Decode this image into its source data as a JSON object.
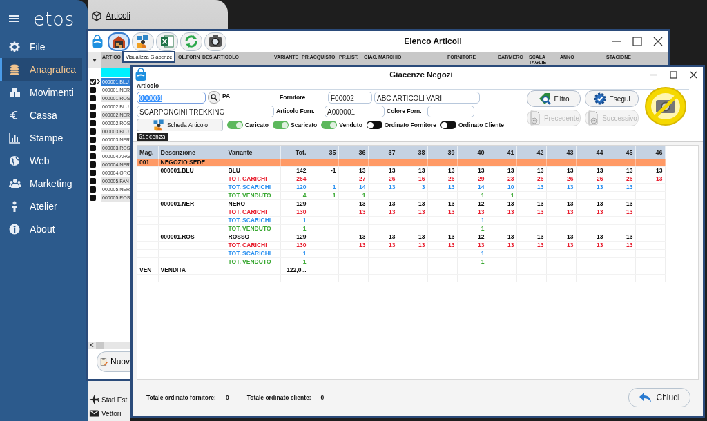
{
  "sidebar": {
    "logo": "etos",
    "items": [
      {
        "label": "File",
        "selected": false
      },
      {
        "label": "Anagrafica",
        "selected": true
      },
      {
        "label": "Movimenti",
        "selected": false
      },
      {
        "label": "Cassa",
        "selected": false
      },
      {
        "label": "Stampe",
        "selected": false
      },
      {
        "label": "Web",
        "selected": false
      },
      {
        "label": "Marketing",
        "selected": false
      },
      {
        "label": "Atelier",
        "selected": false
      },
      {
        "label": "About",
        "selected": false
      }
    ]
  },
  "articoli_tab": {
    "title": "Articoli"
  },
  "elenco_window": {
    "title": "Elenco Articoli",
    "tooltip": "Visualizza Giacenze",
    "toolbar": [
      {
        "selected": true
      },
      {
        "selected": false
      },
      {
        "selected": false
      },
      {
        "selected": false
      },
      {
        "selected": false
      }
    ],
    "columns": [
      "ARTICO",
      "OL.FORN",
      "DES.ARTICOLO",
      "VARIANTE",
      "PR.ACQUISTO",
      "PR.LIST.",
      "GIAC.",
      "MARCHIO",
      "FORNITORE",
      "CAT/MERC",
      "SCALA TAGLIE",
      "ANNO",
      "STAGIONE"
    ],
    "rows": [
      {
        "code": "000001.BLU",
        "checked": true,
        "selected": true
      },
      {
        "code": "000001.NER",
        "checked": false,
        "selected": false
      },
      {
        "code": "000001.ROS",
        "checked": false,
        "selected": false
      },
      {
        "code": "000002.BLU",
        "checked": false,
        "selected": false
      },
      {
        "code": "000002.NER",
        "checked": false,
        "selected": false
      },
      {
        "code": "000002.ROS",
        "checked": false,
        "selected": false
      },
      {
        "code": "000003.BLU",
        "checked": false,
        "selected": false
      },
      {
        "code": "000003.NER",
        "checked": false,
        "selected": false
      },
      {
        "code": "000003.ROS",
        "checked": false,
        "selected": false
      },
      {
        "code": "000004.ARG",
        "checked": false,
        "selected": false
      },
      {
        "code": "000004.NER",
        "checked": false,
        "selected": false
      },
      {
        "code": "000004.ORO",
        "checked": false,
        "selected": false
      },
      {
        "code": "000005.FAN",
        "checked": false,
        "selected": false
      },
      {
        "code": "000005.NER",
        "checked": false,
        "selected": false
      },
      {
        "code": "000005.ROS",
        "checked": false,
        "selected": false
      }
    ],
    "new_button": "Nuov"
  },
  "submenu": {
    "items": [
      "Stati Est",
      "Vettori"
    ]
  },
  "giacenze_window": {
    "title": "Giacenze Negozi",
    "form": {
      "group_label": "Articolo",
      "articolo": "000001",
      "articolo_suffix": "PA",
      "descrizione": "SCARPONCINI TREKKING",
      "fornitore_label": "Fornitore",
      "fornitore_code": "F00002",
      "fornitore_name": "ABC ARTICOLI VARI",
      "articolo_forn_label": "Articolo Forn.",
      "articolo_forn": "A000001",
      "colore_forn_label": "Colore Forn.",
      "scheda_button": "Scheda Articolo",
      "toggles": [
        {
          "label": "Caricato",
          "on": true
        },
        {
          "label": "Scaricato",
          "on": true
        },
        {
          "label": "Venduto",
          "on": true
        },
        {
          "label": "Ordinato Fornitore",
          "on": false
        },
        {
          "label": "Ordinato Cliente",
          "on": false
        }
      ],
      "buttons": [
        {
          "label": "Filtro",
          "disabled": false
        },
        {
          "label": "Esegui",
          "disabled": false
        },
        {
          "label": "Precedente",
          "disabled": true
        },
        {
          "label": "Successivo",
          "disabled": true
        }
      ]
    },
    "tabs": [
      {
        "label": "Giacenza",
        "selected": true
      }
    ],
    "table": {
      "columns": [
        "Mag.",
        "Descrizione",
        "Variante",
        "Tot.",
        "35",
        "36",
        "37",
        "38",
        "39",
        "40",
        "41",
        "42",
        "43",
        "44",
        "45",
        "46"
      ],
      "rows": [
        {
          "kind": "group",
          "mag": "001",
          "descrizione": "NEGOZIO SEDE"
        },
        {
          "kind": "variant",
          "descrizione": "000001.BLU",
          "variante": "BLU",
          "tot": "142",
          "sizes": [
            "-1",
            "13",
            "13",
            "13",
            "13",
            "13",
            "13",
            "13",
            "13",
            "13",
            "13",
            "13"
          ]
        },
        {
          "kind": "carichi",
          "variante": "TOT. CARICHI",
          "tot": "264",
          "sizes": [
            {
              "kind": "empty"
            },
            "27",
            "26",
            "16",
            "26",
            "29",
            "23",
            "26",
            "26",
            "26",
            "26",
            "13"
          ]
        },
        {
          "kind": "scarichi",
          "variante": "TOT. SCARICHI",
          "tot": "120",
          "sizes": [
            "1",
            "14",
            "13",
            "3",
            "13",
            "14",
            "10",
            "13",
            "13",
            "13",
            "13",
            {
              "kind": "empty"
            }
          ]
        },
        {
          "kind": "venduto",
          "variante": "TOT. VENDUTO",
          "tot": "4",
          "sizes": [
            "1",
            "1",
            {
              "kind": "empty"
            },
            {
              "kind": "empty"
            },
            {
              "kind": "empty"
            },
            "1",
            "1",
            {
              "kind": "empty"
            },
            {
              "kind": "empty"
            },
            {
              "kind": "empty"
            },
            {
              "kind": "empty"
            },
            {
              "kind": "empty"
            }
          ]
        },
        {
          "kind": "variant",
          "descrizione": "000001.NER",
          "variante": "NERO",
          "tot": "129",
          "sizes": [
            {
              "kind": "empty"
            },
            "13",
            "13",
            "13",
            "13",
            "12",
            "13",
            "13",
            "13",
            "13",
            "13",
            {
              "kind": "empty"
            }
          ]
        },
        {
          "kind": "carichi",
          "variante": "TOT. CARICHI",
          "tot": "130",
          "sizes": [
            {
              "kind": "empty"
            },
            "13",
            "13",
            "13",
            "13",
            "13",
            "13",
            "13",
            "13",
            "13",
            "13",
            {
              "kind": "empty"
            }
          ]
        },
        {
          "kind": "scarichi",
          "variante": "TOT. SCARICHI",
          "tot": "1",
          "sizes": [
            {
              "kind": "empty"
            },
            {
              "kind": "empty"
            },
            {
              "kind": "empty"
            },
            {
              "kind": "empty"
            },
            {
              "kind": "empty"
            },
            "1",
            {
              "kind": "empty"
            },
            {
              "kind": "empty"
            },
            {
              "kind": "empty"
            },
            {
              "kind": "empty"
            },
            {
              "kind": "empty"
            },
            {
              "kind": "empty"
            }
          ]
        },
        {
          "kind": "venduto",
          "variante": "TOT. VENDUTO",
          "tot": "1",
          "sizes": [
            {
              "kind": "empty"
            },
            {
              "kind": "empty"
            },
            {
              "kind": "empty"
            },
            {
              "kind": "empty"
            },
            {
              "kind": "empty"
            },
            "1",
            {
              "kind": "empty"
            },
            {
              "kind": "empty"
            },
            {
              "kind": "empty"
            },
            {
              "kind": "empty"
            },
            {
              "kind": "empty"
            },
            {
              "kind": "empty"
            }
          ]
        },
        {
          "kind": "variant",
          "descrizione": "000001.ROS",
          "variante": "ROSSO",
          "tot": "129",
          "sizes": [
            {
              "kind": "empty"
            },
            "13",
            "13",
            "13",
            "13",
            "12",
            "13",
            "13",
            "13",
            "13",
            "13",
            {
              "kind": "empty"
            }
          ]
        },
        {
          "kind": "carichi",
          "variante": "TOT. CARICHI",
          "tot": "130",
          "sizes": [
            {
              "kind": "empty"
            },
            "13",
            "13",
            "13",
            "13",
            "13",
            "13",
            "13",
            "13",
            "13",
            "13",
            {
              "kind": "empty"
            }
          ]
        },
        {
          "kind": "scarichi",
          "variante": "TOT. SCARICHI",
          "tot": "1",
          "sizes": [
            {
              "kind": "empty"
            },
            {
              "kind": "empty"
            },
            {
              "kind": "empty"
            },
            {
              "kind": "empty"
            },
            {
              "kind": "empty"
            },
            "1",
            {
              "kind": "empty"
            },
            {
              "kind": "empty"
            },
            {
              "kind": "empty"
            },
            {
              "kind": "empty"
            },
            {
              "kind": "empty"
            },
            {
              "kind": "empty"
            }
          ]
        },
        {
          "kind": "venduto",
          "variante": "TOT. VENDUTO",
          "tot": "1",
          "sizes": [
            {
              "kind": "empty"
            },
            {
              "kind": "empty"
            },
            {
              "kind": "empty"
            },
            {
              "kind": "empty"
            },
            {
              "kind": "empty"
            },
            "1",
            {
              "kind": "empty"
            },
            {
              "kind": "empty"
            },
            {
              "kind": "empty"
            },
            {
              "kind": "empty"
            },
            {
              "kind": "empty"
            },
            {
              "kind": "empty"
            }
          ]
        },
        {
          "kind": "total",
          "mag": "VEN",
          "descrizione": "VENDITA",
          "tot": "122,0..."
        }
      ]
    },
    "footer": {
      "fornitore_label": "Totale ordinato fornitore:",
      "fornitore_value": "0",
      "cliente_label": "Totale ordinato cliente:",
      "cliente_value": "0",
      "close_button": "Chiudi"
    }
  }
}
